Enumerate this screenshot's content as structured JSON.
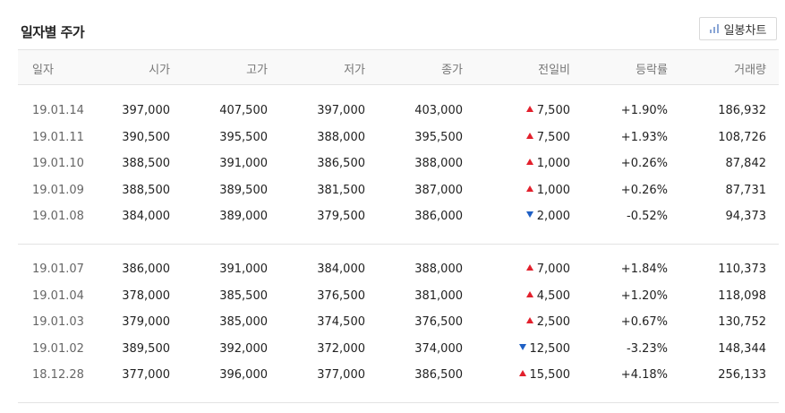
{
  "title": "일자별 주가",
  "chart_button": {
    "label": "일봉차트",
    "icon": "bar-chart-icon"
  },
  "columns": [
    "일자",
    "시가",
    "고가",
    "저가",
    "종가",
    "전일비",
    "등락률",
    "거래량"
  ],
  "colors": {
    "up": "#e2202c",
    "down": "#1e5fc4"
  },
  "groups": [
    [
      {
        "date": "19.01.14",
        "open": "397,000",
        "high": "407,500",
        "low": "397,000",
        "close": "403,000",
        "dir": "up",
        "change": "7,500",
        "rate": "+1.90%",
        "volume": "186,932"
      },
      {
        "date": "19.01.11",
        "open": "390,500",
        "high": "395,500",
        "low": "388,000",
        "close": "395,500",
        "dir": "up",
        "change": "7,500",
        "rate": "+1.93%",
        "volume": "108,726"
      },
      {
        "date": "19.01.10",
        "open": "388,500",
        "high": "391,000",
        "low": "386,500",
        "close": "388,000",
        "dir": "up",
        "change": "1,000",
        "rate": "+0.26%",
        "volume": "87,842"
      },
      {
        "date": "19.01.09",
        "open": "388,500",
        "high": "389,500",
        "low": "381,500",
        "close": "387,000",
        "dir": "up",
        "change": "1,000",
        "rate": "+0.26%",
        "volume": "87,731"
      },
      {
        "date": "19.01.08",
        "open": "384,000",
        "high": "389,000",
        "low": "379,500",
        "close": "386,000",
        "dir": "down",
        "change": "2,000",
        "rate": "-0.52%",
        "volume": "94,373"
      }
    ],
    [
      {
        "date": "19.01.07",
        "open": "386,000",
        "high": "391,000",
        "low": "384,000",
        "close": "388,000",
        "dir": "up",
        "change": "7,000",
        "rate": "+1.84%",
        "volume": "110,373"
      },
      {
        "date": "19.01.04",
        "open": "378,000",
        "high": "385,500",
        "low": "376,500",
        "close": "381,000",
        "dir": "up",
        "change": "4,500",
        "rate": "+1.20%",
        "volume": "118,098"
      },
      {
        "date": "19.01.03",
        "open": "379,000",
        "high": "385,000",
        "low": "374,500",
        "close": "376,500",
        "dir": "up",
        "change": "2,500",
        "rate": "+0.67%",
        "volume": "130,752"
      },
      {
        "date": "19.01.02",
        "open": "389,500",
        "high": "392,000",
        "low": "372,000",
        "close": "374,000",
        "dir": "down",
        "change": "12,500",
        "rate": "-3.23%",
        "volume": "148,344"
      },
      {
        "date": "18.12.28",
        "open": "377,000",
        "high": "396,000",
        "low": "377,000",
        "close": "386,500",
        "dir": "up",
        "change": "15,500",
        "rate": "+4.18%",
        "volume": "256,133"
      }
    ]
  ]
}
